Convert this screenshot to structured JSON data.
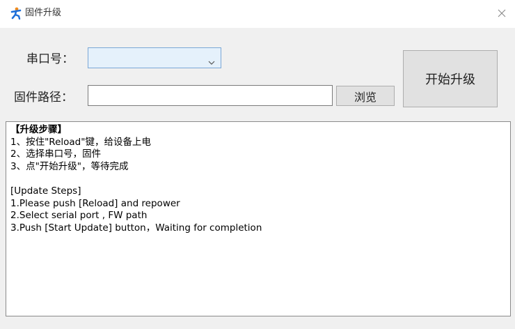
{
  "window": {
    "title": "固件升级",
    "icon": "app-logo-icon",
    "close_icon": "close-icon"
  },
  "form": {
    "port_label": "串口号：",
    "port_value": "",
    "path_label": "固件路径：",
    "path_value": "",
    "browse_label": "浏览",
    "start_label": "开始升级"
  },
  "log": {
    "lines": [
      "【升级步骤】",
      "1、按住\"Reload\"键，给设备上电",
      "2、选择串口号，固件",
      "3、点\"开始升级\"，等待完成",
      "",
      "[Update Steps]",
      "1.Please push [Reload] and repower",
      "2.Select serial port , FW path",
      "3.Push [Start Update] button，Waiting for completion"
    ]
  },
  "colors": {
    "accent_icon": "#1e6fd9",
    "combo_bg": "#e5f1fb",
    "button_bg": "#e1e1e1",
    "panel_bg": "#f0f0f0"
  }
}
